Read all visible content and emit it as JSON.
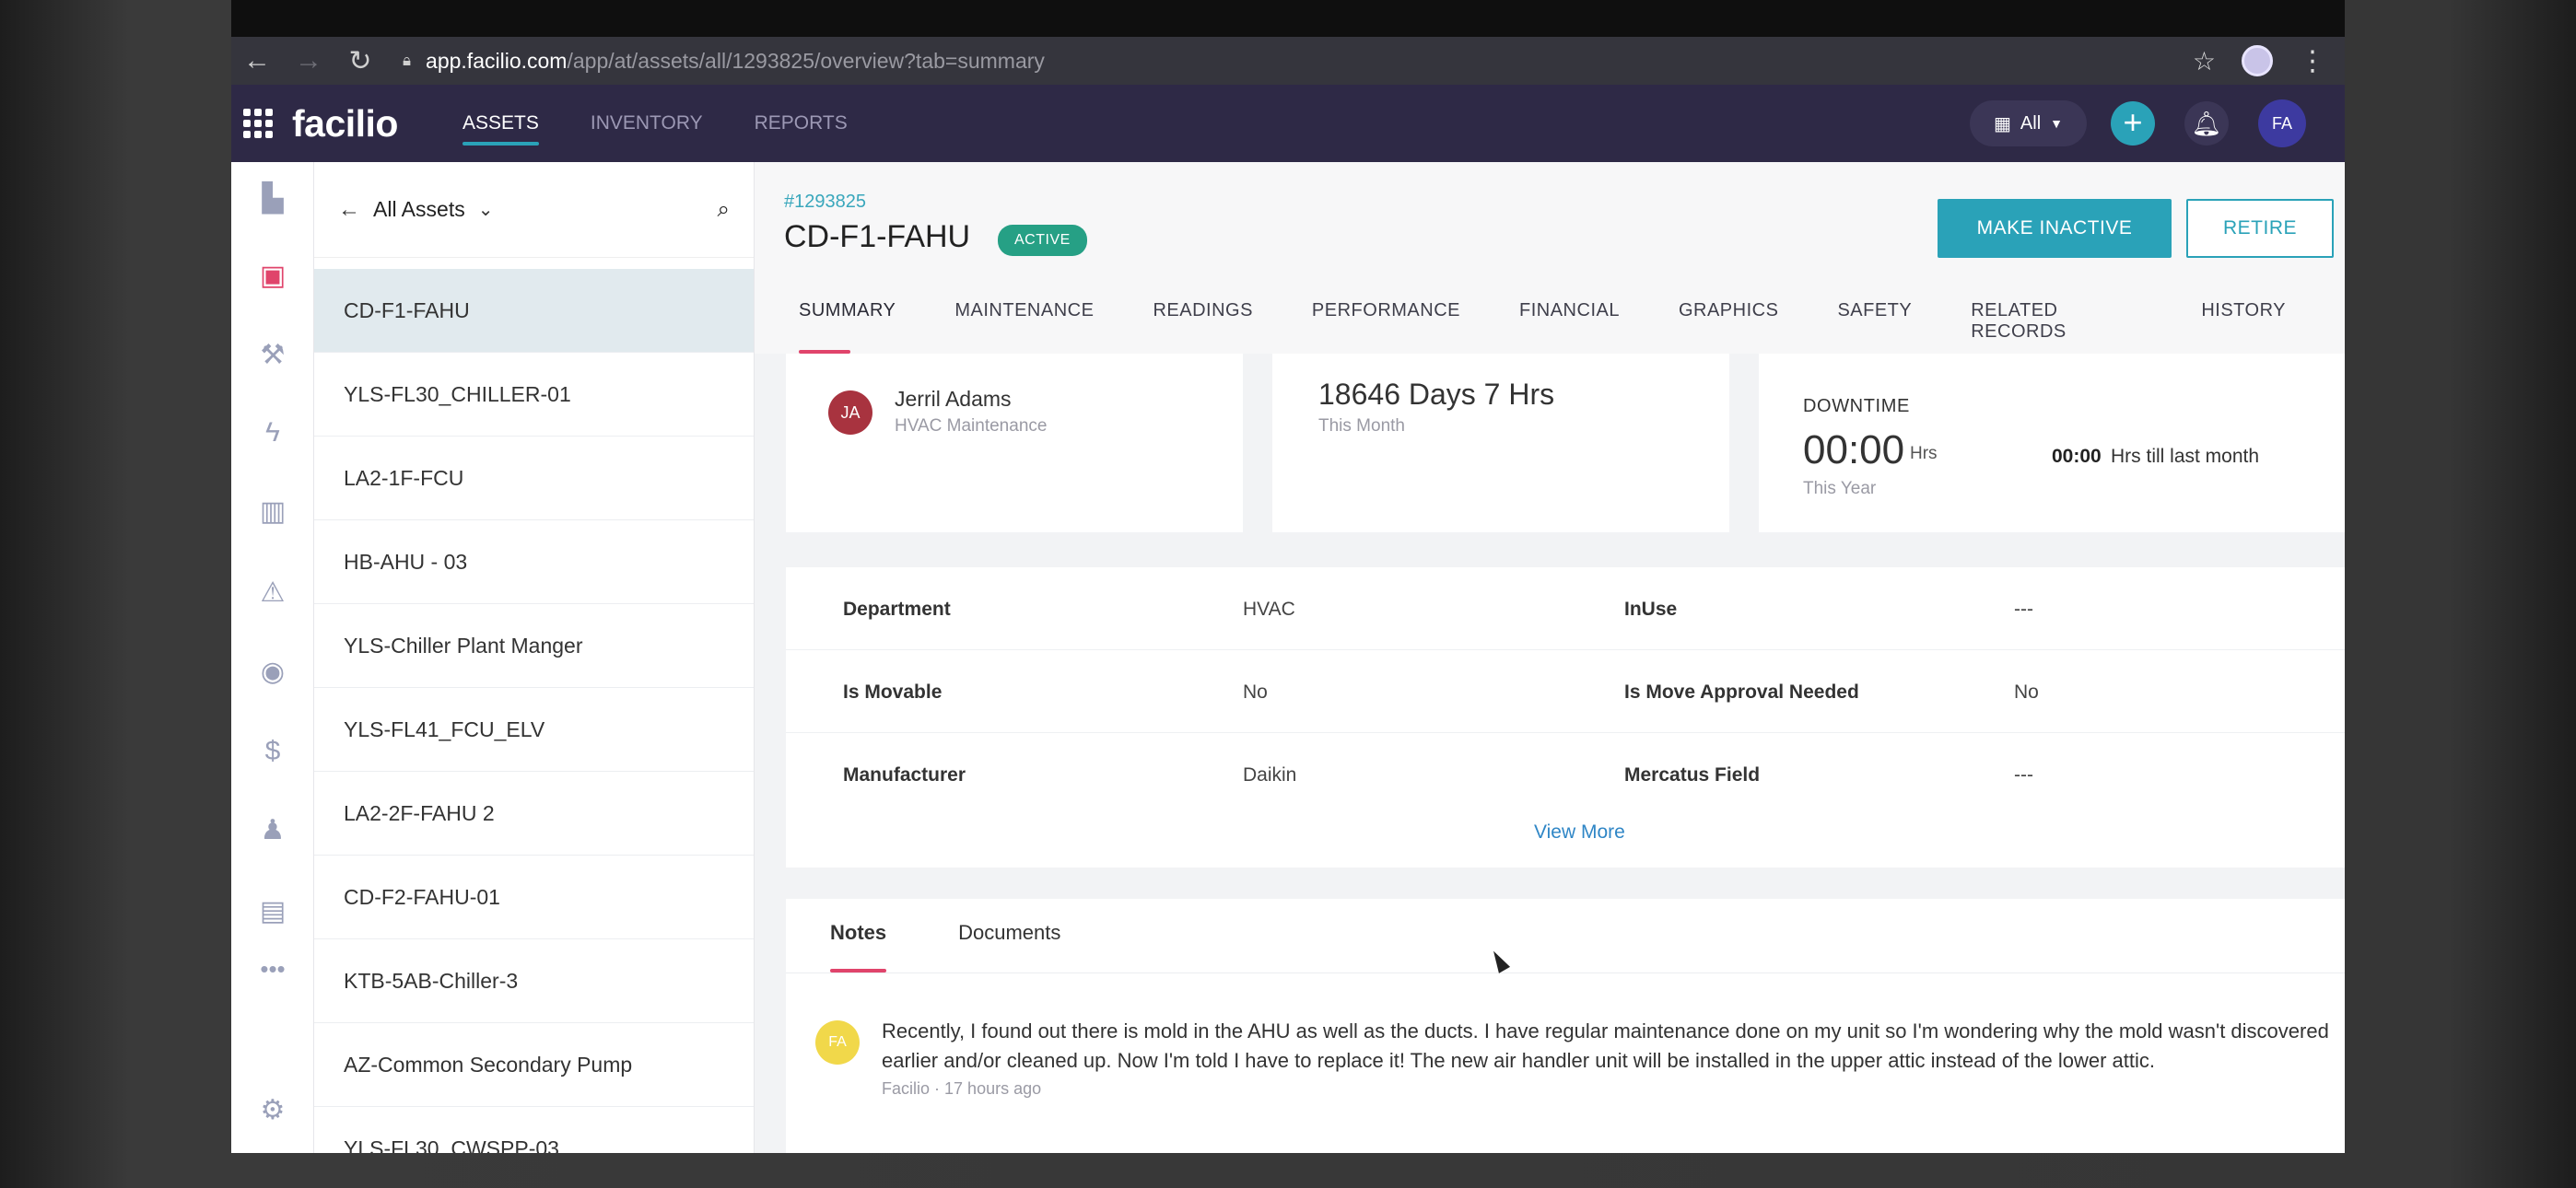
{
  "browser": {
    "url_host": "app.facilio.com",
    "url_path": "/app/at/assets/all/1293825/overview?tab=summary"
  },
  "topnav": {
    "logo": "facilio",
    "tabs": [
      "ASSETS",
      "INVENTORY",
      "REPORTS"
    ],
    "active_tab": "ASSETS",
    "site_selector": "All",
    "avatar": "FA"
  },
  "list": {
    "title": "All Assets",
    "items": [
      "CD-F1-FAHU",
      "YLS-FL30_CHILLER-01",
      "LA2-1F-FCU",
      "HB-AHU - 03",
      "YLS-Chiller Plant Manger",
      "YLS-FL41_FCU_ELV",
      "LA2-2F-FAHU 2",
      "CD-F2-FAHU-01",
      "KTB-5AB-Chiller-3",
      "AZ-Common Secondary Pump",
      "YLS-FL30_CWSPP-03"
    ],
    "selected_index": 0
  },
  "asset": {
    "id": "#1293825",
    "name": "CD-F1-FAHU",
    "status": "ACTIVE",
    "make_inactive": "MAKE INACTIVE",
    "retire": "RETIRE"
  },
  "tabs": [
    "SUMMARY",
    "MAINTENANCE",
    "READINGS",
    "PERFORMANCE",
    "FINANCIAL",
    "GRAPHICS",
    "SAFETY",
    "RELATED RECORDS",
    "HISTORY"
  ],
  "owner": {
    "initials": "JA",
    "name": "Jerril Adams",
    "team": "HVAC Maintenance"
  },
  "uptime": {
    "value": "18646 Days 7 Hrs",
    "period": "This Month"
  },
  "downtime": {
    "title": "DOWNTIME",
    "value": "00:00",
    "unit": "Hrs",
    "period": "This Year",
    "last_value": "00:00",
    "last_label": "Hrs till last month"
  },
  "details": {
    "rows": [
      {
        "label1": "Department",
        "value1": "HVAC",
        "label2": "InUse",
        "value2": "---"
      },
      {
        "label1": "Is Movable",
        "value1": "No",
        "label2": "Is Move Approval Needed",
        "value2": "No"
      },
      {
        "label1": "Manufacturer",
        "value1": "Daikin",
        "label2": "Mercatus Field",
        "value2": "---"
      }
    ],
    "view_more": "View More"
  },
  "notes": {
    "tabs": [
      "Notes",
      "Documents"
    ],
    "note_initials": "FA",
    "note_text": "Recently, I found out there is mold in the AHU as well as the ducts. I have regular maintenance done on my unit so I'm wondering why the mold wasn't discovered earlier and/or cleaned up. Now I'm told I have to replace it! The new air handler unit will be installed in the upper attic instead of the lower attic.",
    "note_author": "Facilio",
    "note_time": "17 hours ago"
  },
  "colors": {
    "accent": "#2aa2b8",
    "nav_bg": "#2e2946",
    "active_tab_underline": "#e0446b",
    "status_green": "#26a085"
  },
  "icons": [
    "grid-icon",
    "back-icon",
    "forward-icon",
    "reload-icon",
    "lock-icon",
    "star-icon",
    "building-icon",
    "plus-icon",
    "bell-icon",
    "search-icon",
    "chevron-down-icon",
    "settings-icon"
  ]
}
